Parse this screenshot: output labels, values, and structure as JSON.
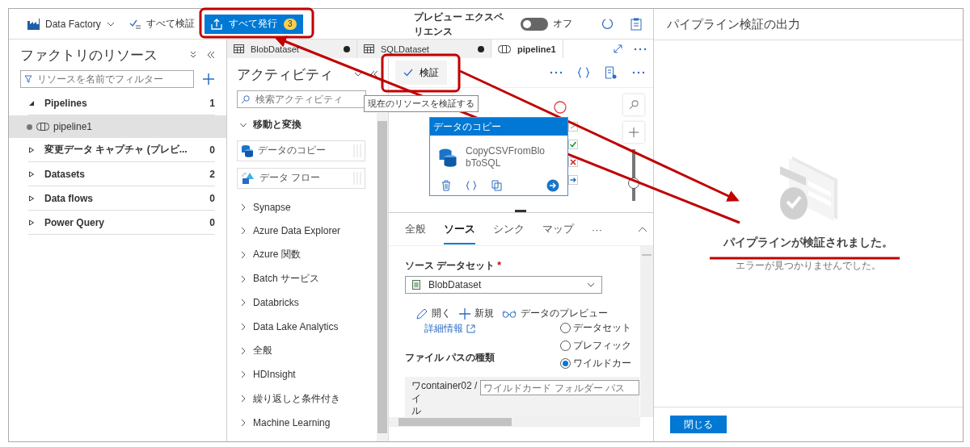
{
  "toolbar": {
    "factory": "Data Factory",
    "validate_all": "すべて検証",
    "publish_all": {
      "label": "すべて発行",
      "count": "3"
    },
    "preview": {
      "label": "プレビュー エクスペリエンス",
      "state": "オフ",
      "on": false
    }
  },
  "resources": {
    "title": "ファクトリのリソース",
    "filter_placeholder": "リソースを名前でフィルター",
    "groups": [
      {
        "name": "Pipelines",
        "count": "1",
        "expanded": true,
        "children": [
          {
            "name": "pipeline1",
            "selected": true
          }
        ]
      },
      {
        "name": "変更データ キャプチャ (プレビ...",
        "count": "0",
        "expanded": false
      },
      {
        "name": "Datasets",
        "count": "2",
        "expanded": false
      },
      {
        "name": "Data flows",
        "count": "0",
        "expanded": false
      },
      {
        "name": "Power Query",
        "count": "0",
        "expanded": false
      }
    ]
  },
  "tabs": [
    {
      "label": "BlobDataset",
      "kind": "dataset",
      "unsaved": true,
      "selected": false
    },
    {
      "label": "SQLDataset",
      "kind": "dataset",
      "unsaved": true,
      "selected": false
    },
    {
      "label": "pipeline1",
      "kind": "pipeline",
      "unsaved": false,
      "selected": true
    }
  ],
  "activities": {
    "title": "アクティビティ",
    "search_placeholder": "検索アクティビティ",
    "groups": [
      {
        "name": "移動と変換",
        "expanded": true,
        "items": [
          {
            "label": "データのコピー",
            "kind": "copy"
          },
          {
            "label": "データ フロー",
            "kind": "dataflow"
          }
        ]
      },
      {
        "name": "Synapse",
        "expanded": false
      },
      {
        "name": "Azure Data Explorer",
        "expanded": false
      },
      {
        "name": "Azure 関数",
        "expanded": false
      },
      {
        "name": "Batch サービス",
        "expanded": false
      },
      {
        "name": "Databricks",
        "expanded": false
      },
      {
        "name": "Data Lake Analytics",
        "expanded": false
      },
      {
        "name": "全般",
        "expanded": false
      },
      {
        "name": "HDInsight",
        "expanded": false
      },
      {
        "name": "繰り返しと条件付き",
        "expanded": false
      },
      {
        "name": "Machine Learning",
        "expanded": false
      }
    ]
  },
  "canvas": {
    "validate": "検証",
    "tooltip": "現在のリソースを検証する",
    "activity": {
      "type": "データのコピー",
      "name": "CopyCSVFromBlobToSQL"
    },
    "zoom": {
      "level": 0.35
    }
  },
  "properties": {
    "tabs": [
      {
        "label": "全般",
        "selected": false
      },
      {
        "label": "ソース",
        "selected": true
      },
      {
        "label": "シンク",
        "selected": false
      },
      {
        "label": "マップ",
        "selected": false
      },
      {
        "label": "···",
        "selected": false
      }
    ],
    "dataset_label": "ソース データセット",
    "dataset_required": "*",
    "dataset": "BlobDataset",
    "actions": [
      {
        "label": "開く",
        "kind": "edit"
      },
      {
        "label": "新規",
        "kind": "new"
      },
      {
        "label": "データのプレビュー",
        "kind": "preview"
      }
    ],
    "more_info": "詳細情報",
    "file_path_label": "ファイル パスの種類",
    "options": [
      {
        "label": "データセット",
        "selected": false
      },
      {
        "label": "プレフィック",
        "selected": false
      },
      {
        "label": "ワイルドカー",
        "selected": true
      }
    ],
    "path_label": "ワイル",
    "container": "container02 /",
    "folder_placeholder": "ワイルドカード フォルダー パス"
  },
  "validation": {
    "title": "パイプライン検証の出力",
    "message": "パイプラインが検証されました。",
    "detail": "エラーが見つかりませんでした。",
    "close": "閉じる"
  }
}
